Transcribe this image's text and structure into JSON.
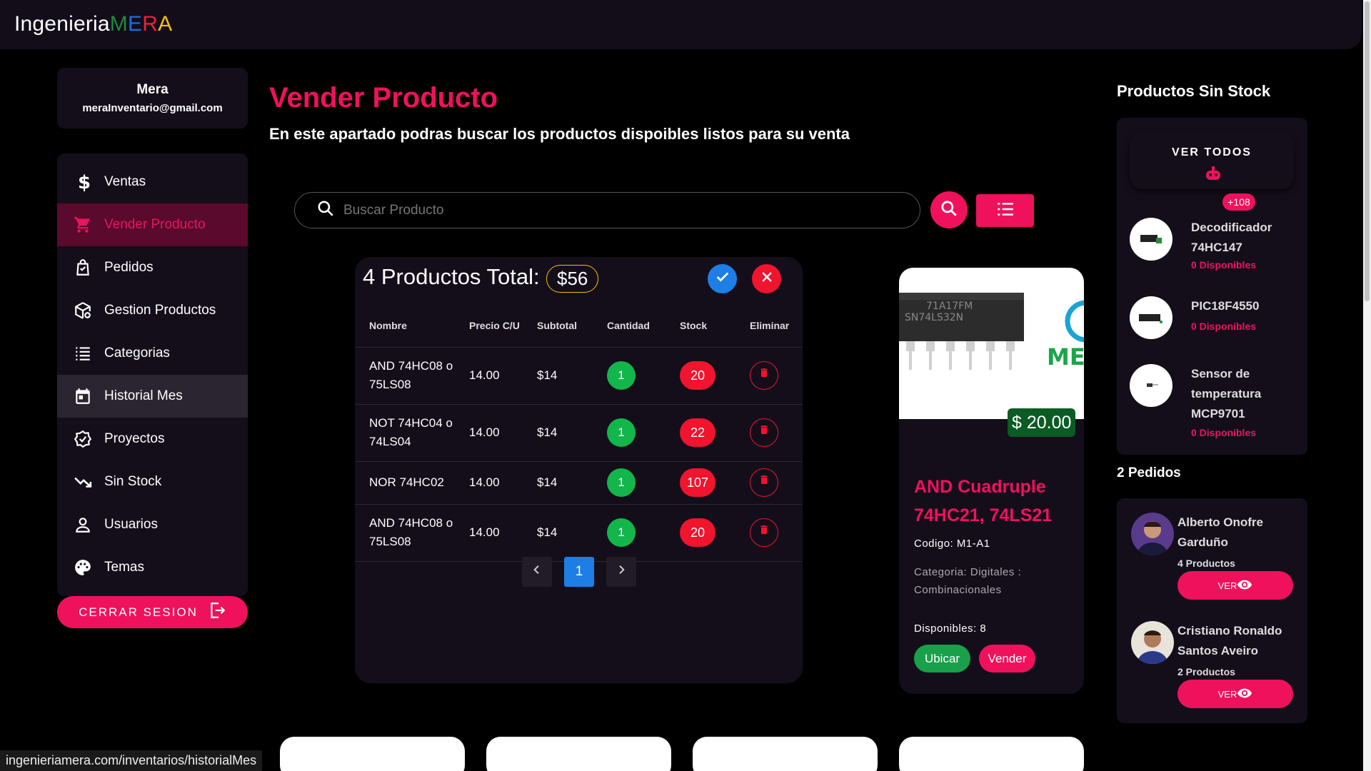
{
  "brand": {
    "part1": "Ingenieria",
    "m": "M",
    "e": "E",
    "r": "R",
    "a": "A"
  },
  "user": {
    "name": "Mera",
    "email": "meraInventario@gmail.com"
  },
  "sidebar": {
    "items": [
      {
        "label": "Ventas",
        "icon": "dollar-icon"
      },
      {
        "label": "Vender Producto",
        "icon": "cart-icon"
      },
      {
        "label": "Pedidos",
        "icon": "orders-icon"
      },
      {
        "label": "Gestion Productos",
        "icon": "package-gear-icon"
      },
      {
        "label": "Categorias",
        "icon": "list-icon"
      },
      {
        "label": "Historial Mes",
        "icon": "calendar-icon"
      },
      {
        "label": "Proyectos",
        "icon": "badge-check-icon"
      },
      {
        "label": "Sin Stock",
        "icon": "trend-down-icon"
      },
      {
        "label": "Usuarios",
        "icon": "user-icon"
      },
      {
        "label": "Temas",
        "icon": "palette-icon"
      }
    ],
    "logout": "CERRAR SESION"
  },
  "header": {
    "title": "Vender Producto",
    "subtitle": "En este apartado podras buscar los productos dispoibles listos para su venta"
  },
  "search": {
    "placeholder": "Buscar Producto"
  },
  "cart": {
    "title": "4 Productos Total:",
    "total": "$56",
    "columns": [
      "Nombre",
      "Precio C/U",
      "Subtotal",
      "Cantidad",
      "Stock",
      "Eliminar"
    ],
    "rows": [
      {
        "name": "AND 74HC08 o 75LS08",
        "price": "14.00",
        "subtotal": "$14",
        "qty": "1",
        "stock": "20"
      },
      {
        "name": "NOT 74HC04 o 74LS04",
        "price": "14.00",
        "subtotal": "$14",
        "qty": "1",
        "stock": "22"
      },
      {
        "name": "NOR 74HC02",
        "price": "14.00",
        "subtotal": "$14",
        "qty": "1",
        "stock": "107"
      },
      {
        "name": "AND 74HC08 o 75LS08",
        "price": "14.00",
        "subtotal": "$14",
        "qty": "1",
        "stock": "20"
      }
    ],
    "page": "1"
  },
  "product": {
    "chip_text1": "71A17FM",
    "chip_text2": "SN74LS32N",
    "logo_text": "ME",
    "price": "$ 20.00",
    "name": "AND Cuadruple 74HC21, 74LS21",
    "code": "Codigo: M1-A1",
    "category": "Categoria: Digitales : Combinacionales",
    "available": "Disponibles: 8",
    "btn_locate": "Ubicar",
    "btn_sell": "Vender"
  },
  "out_of_stock": {
    "title": "Productos Sin Stock",
    "view_all": "VER TODOS",
    "badge": "+108",
    "items": [
      {
        "name": "Decodificador 74HC147",
        "stock": "0 Disponibles"
      },
      {
        "name": "PIC18F4550",
        "stock": "0 Disponibles"
      },
      {
        "name": "Sensor de temperatura MCP9701",
        "stock": "0 Disponibles"
      }
    ]
  },
  "orders": {
    "title": "2 Pedidos",
    "items": [
      {
        "name": "Alberto Onofre Garduño",
        "count": "4 Productos",
        "button": "VER"
      },
      {
        "name": "Cristiano Ronaldo Santos Aveiro",
        "count": "2 Productos",
        "button": "VER"
      }
    ]
  },
  "status_url": "ingenieriamera.com/inventarios/historialMes",
  "colors": {
    "accent": "#f0115d",
    "panel": "#140e1b",
    "success": "#12b64b",
    "danger": "#f0142e",
    "info": "#1e7ee6"
  }
}
